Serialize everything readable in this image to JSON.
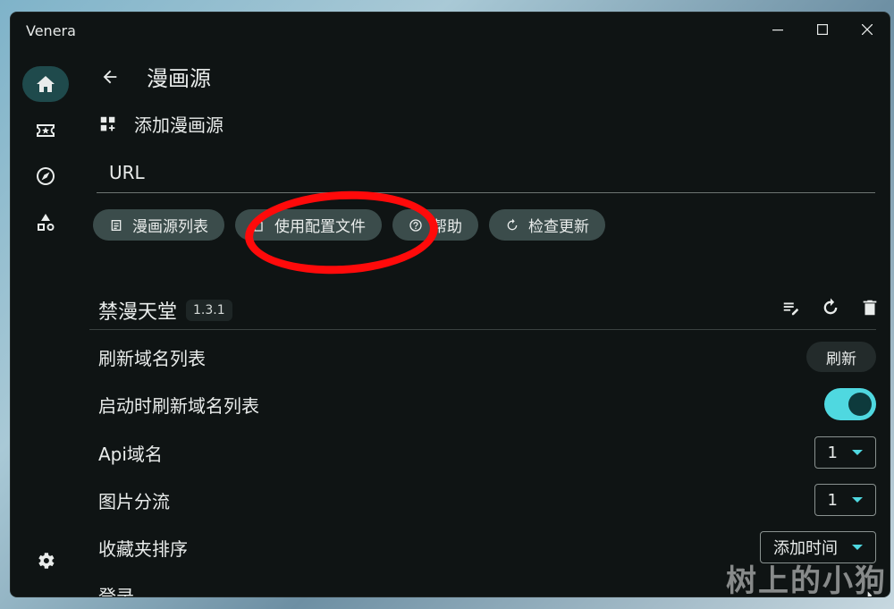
{
  "window": {
    "title": "Venera"
  },
  "rail": {
    "items": [
      {
        "icon": "home-icon",
        "active": true
      },
      {
        "icon": "ticket-star-icon",
        "active": false
      },
      {
        "icon": "compass-icon",
        "active": false
      },
      {
        "icon": "category-shapes-icon",
        "active": false
      }
    ],
    "settings_icon": "gear-icon"
  },
  "header": {
    "title": "漫画源"
  },
  "add_source": {
    "label": "添加漫画源"
  },
  "url_field": {
    "placeholder": "URL"
  },
  "chips": [
    {
      "label": "漫画源列表",
      "icon": "list-icon"
    },
    {
      "label": "使用配置文件",
      "icon": "file-icon"
    },
    {
      "label": "帮助",
      "icon": "help-icon"
    },
    {
      "label": "检查更新",
      "icon": "refresh-icon"
    }
  ],
  "source": {
    "name": "禁漫天堂",
    "version": "1.3.1"
  },
  "settings": {
    "refresh_domains": {
      "label": "刷新域名列表",
      "button": "刷新"
    },
    "refresh_on_start": {
      "label": "启动时刷新域名列表",
      "enabled": true
    },
    "api_domain": {
      "label": "Api域名",
      "value": "1"
    },
    "image_stream": {
      "label": "图片分流",
      "value": "1"
    },
    "favorites_sort": {
      "label": "收藏夹排序",
      "value": "添加时间"
    },
    "login": {
      "label": "登录"
    }
  },
  "watermark": "树上的小狗",
  "colors": {
    "accent": "#4fd8e0",
    "annotation": "#ff0a0a",
    "background": "#0f1414"
  }
}
